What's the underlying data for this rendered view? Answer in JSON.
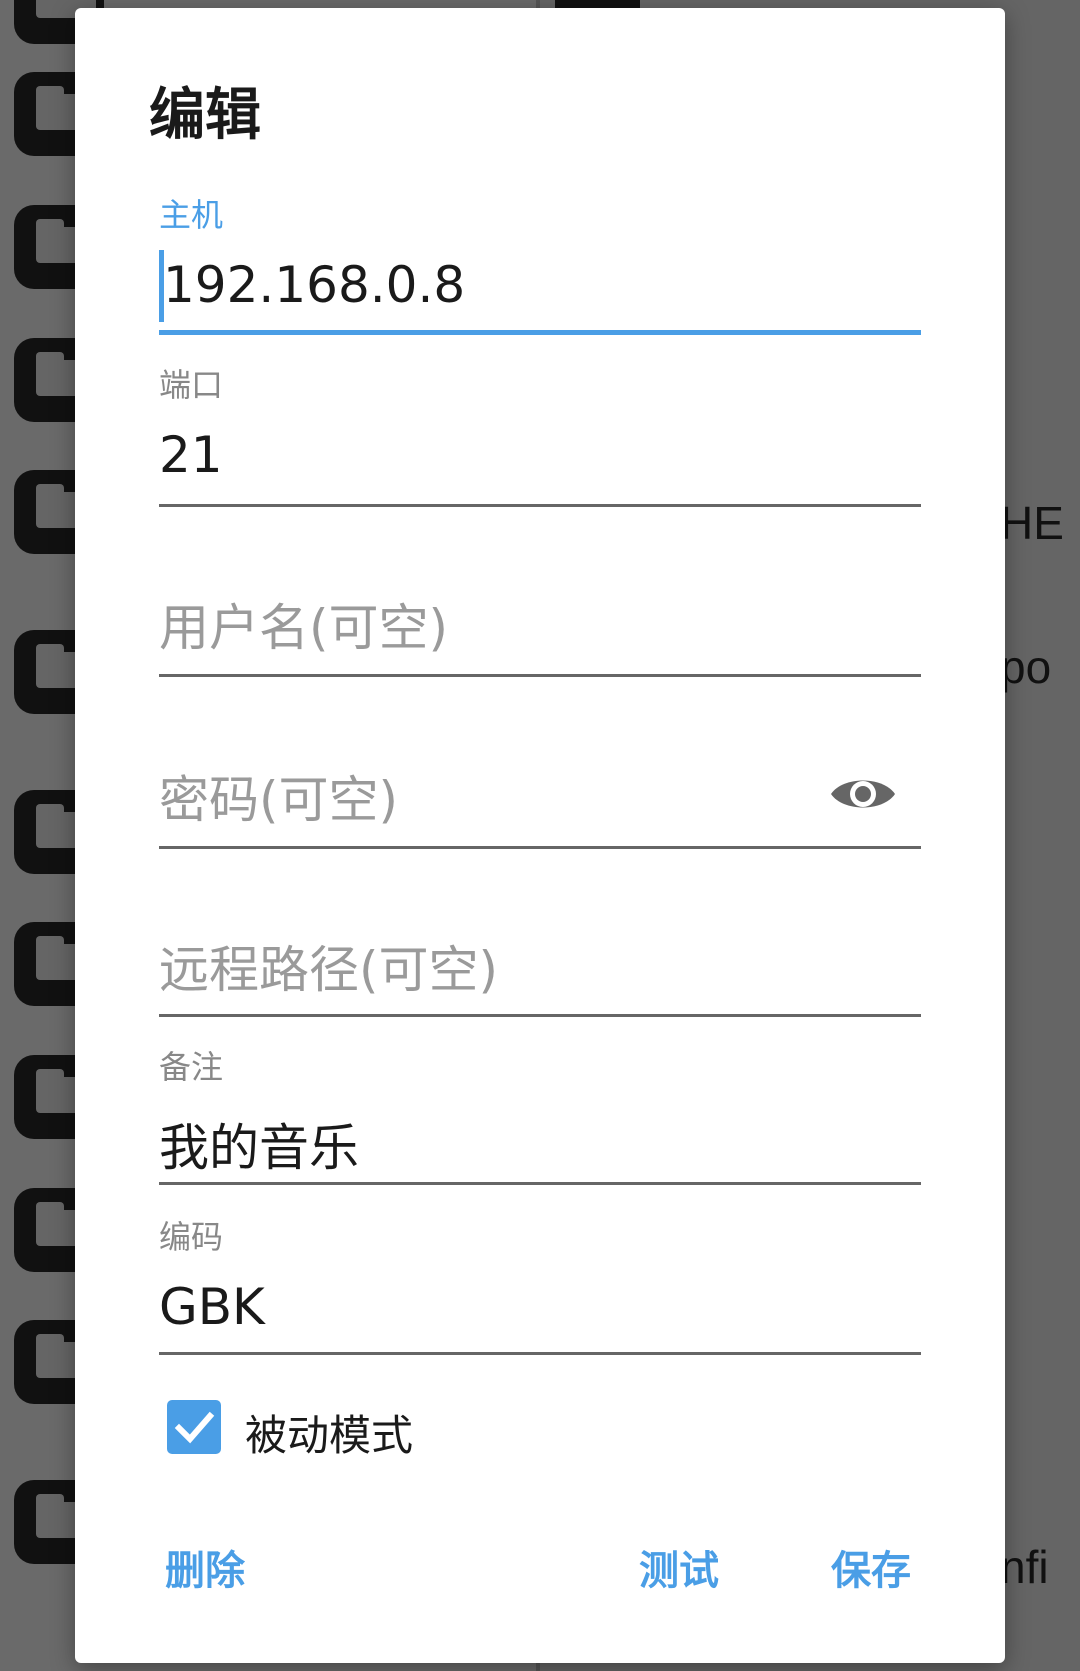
{
  "background": {
    "partial_texts": [
      "HE",
      "po",
      "nfi"
    ]
  },
  "dialog": {
    "title": "编辑",
    "fields": {
      "host": {
        "label": "主机",
        "value": "192.168.0.8"
      },
      "port": {
        "label": "端口",
        "value": "21"
      },
      "username": {
        "placeholder": "用户名(可空)"
      },
      "password": {
        "placeholder": "密码(可空)",
        "toggle_icon": "eye-icon"
      },
      "remote_path": {
        "placeholder": "远程路径(可空)"
      },
      "note": {
        "label": "备注",
        "value": "我的音乐"
      },
      "encoding": {
        "label": "编码",
        "value": "GBK"
      }
    },
    "passive_mode": {
      "label": "被动模式",
      "checked": true
    },
    "buttons": {
      "delete": "删除",
      "test": "测试",
      "save": "保存"
    }
  },
  "colors": {
    "accent": "#4a9ee6",
    "scrim": "#656565",
    "dialog_bg": "#ffffff"
  }
}
